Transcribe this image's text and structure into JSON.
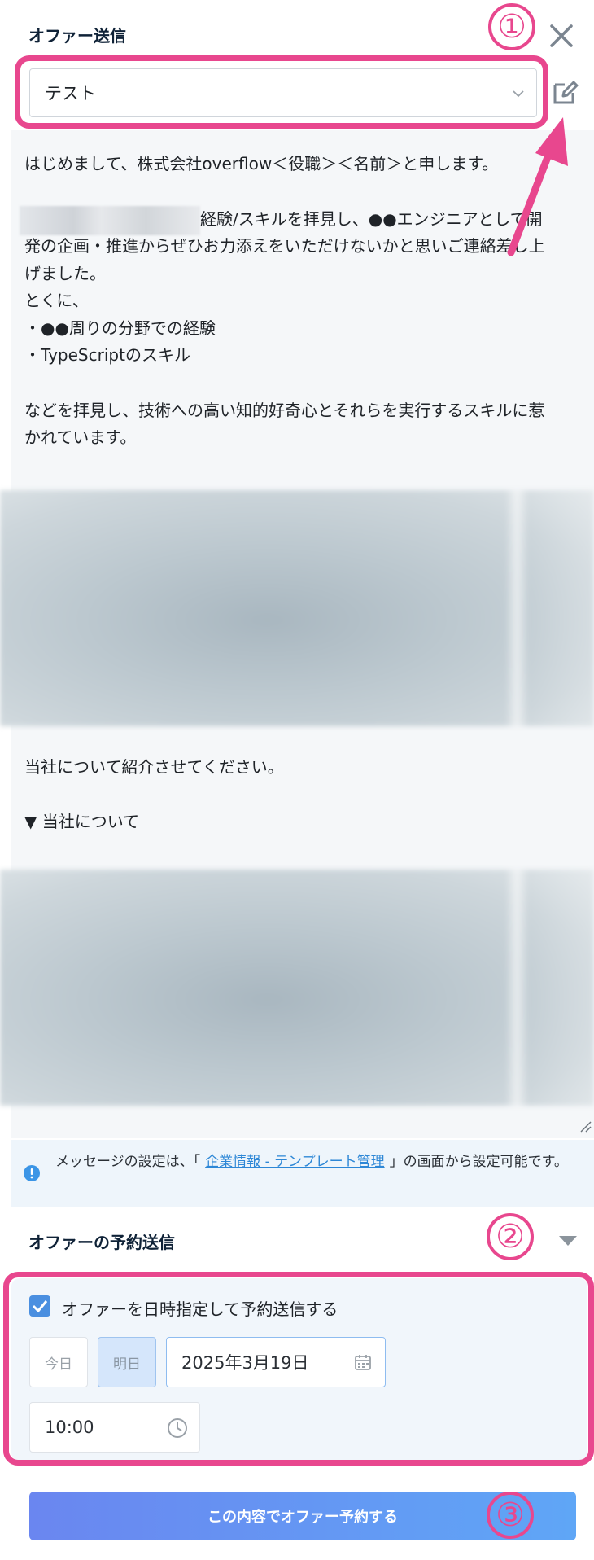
{
  "header": {
    "title": "オファー送信",
    "close_icon": "close-icon",
    "edit_icon": "edit-icon"
  },
  "template_select": {
    "value": "テスト"
  },
  "message": {
    "block1": "はじめまして、株式会社overflow＜役職＞＜名前＞と申します。",
    "line2_suffix": "経験/スキルを拝見し、●●エンジニアとして開",
    "block1_rest": "発の企画・推進からぜひお力添えをいただけないかと思いご連絡差し上\nげました。\nとくに、\n・●●周りの分野での経験\n・TypeScriptのスキル\n\nなどを拝見し、技術への高い知的好奇心とそれらを実行するスキルに惹\nかれています。",
    "block2": "当社について紹介させてください。\n\n▼ 当社について"
  },
  "notice": {
    "prefix": "メッセージの設定は、「",
    "link": "企業情報 - テンプレート管理",
    "suffix": "」の画面から設定可能です。"
  },
  "schedule": {
    "title": "オファーの予約送信",
    "checkbox_label": "オファーを日時指定して予約送信する",
    "checked": true,
    "today": "今日",
    "tomorrow": "明日",
    "date": "2025年3月19日",
    "time": "10:00"
  },
  "submit": {
    "label": "この内容でオファー予約する"
  },
  "annotations": {
    "n1": "①",
    "n2": "②",
    "n3": "③",
    "color": "#e8478e"
  },
  "colors": {
    "primary_gradient_start": "#6a86f0",
    "primary_gradient_end": "#5fa6f6",
    "link": "#2d87d6",
    "checkbox": "#4a8fe0"
  }
}
